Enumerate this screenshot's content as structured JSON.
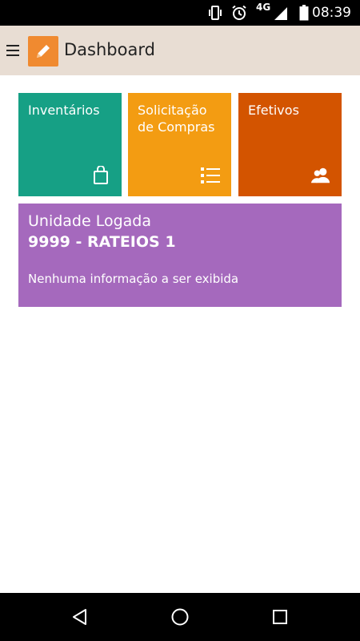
{
  "status_bar": {
    "time": "08:39",
    "network": "4G",
    "icons": [
      "vibrate-icon",
      "alarm-icon",
      "signal-icon",
      "battery-icon"
    ]
  },
  "app_bar": {
    "title": "Dashboard",
    "logo_icon": "pencil-icon",
    "menu_icon": "hamburger-icon"
  },
  "tiles": [
    {
      "label": "Inventários",
      "icon": "shopping-bag-icon",
      "color": "#16a085"
    },
    {
      "label": "Solicitação de Compras",
      "icon": "list-icon",
      "color": "#f39c12"
    },
    {
      "label": "Efetivos",
      "icon": "users-icon",
      "color": "#d35400"
    }
  ],
  "unit_card": {
    "title": "Unidade Logada",
    "code": "9999 - RATEIOS 1",
    "info": "Nenhuma informação a ser exibida",
    "color": "#a569bd"
  },
  "nav_bar": {
    "buttons": [
      "back-icon",
      "home-icon",
      "recents-icon"
    ]
  }
}
